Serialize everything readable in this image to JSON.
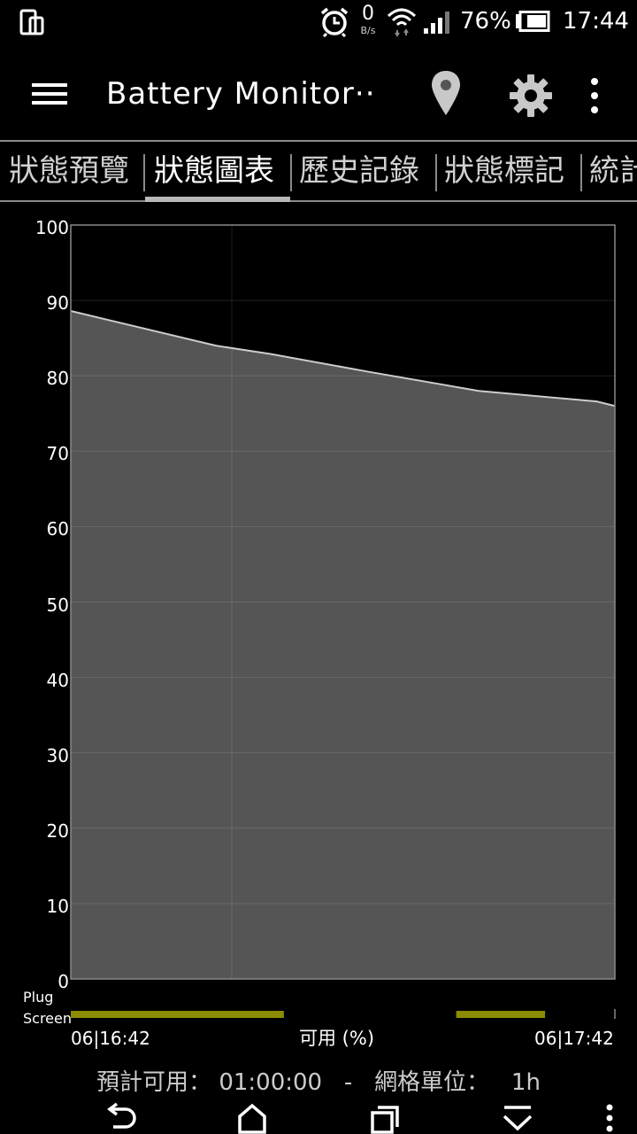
{
  "status_bar": {
    "net_speed": "0",
    "net_unit": "B/s",
    "battery_percent": "76%",
    "time": "17:44",
    "icons": [
      "screen-rotate-icon",
      "alarm-icon",
      "wifi-icon",
      "cell-signal-icon",
      "battery-icon"
    ]
  },
  "appbar": {
    "title": "Battery Monitor··",
    "icons": [
      "menu-icon",
      "location-pin-icon",
      "gear-icon",
      "more-vert-icon"
    ]
  },
  "tabs": [
    {
      "label": "狀態預覽",
      "selected": false
    },
    {
      "label": "狀態圖表",
      "selected": true
    },
    {
      "label": "歷史記錄",
      "selected": false
    },
    {
      "label": "狀態標記",
      "selected": false
    },
    {
      "label": "統計",
      "selected": false
    }
  ],
  "chart_data": {
    "type": "area",
    "xlabel": "可用 (%)",
    "ylim": [
      0,
      100
    ],
    "yticks": [
      "100",
      "90",
      "80",
      "70",
      "60",
      "50",
      "40",
      "30",
      "20",
      "10",
      "0"
    ],
    "x_start_label": "06|16:42",
    "x_end_label": "06|17:42",
    "x_range_minutes": [
      0,
      60
    ],
    "x": [
      0,
      16,
      22,
      33,
      45,
      58,
      60
    ],
    "y": [
      88.6,
      84.0,
      82.9,
      80.5,
      78.0,
      76.6,
      76.0
    ],
    "grid": true,
    "fill_color": "#555555",
    "line_color": "#cccccc",
    "track_labels": {
      "plug": "Plug",
      "screen": "Screen"
    },
    "screen_on_segments_minutes": [
      [
        0,
        23.5
      ],
      [
        42.5,
        52.3
      ]
    ],
    "track_color": "#8c8c00"
  },
  "footer": {
    "estimate_label": "預計可用：",
    "estimate_value": "01:00:00",
    "separator": "-",
    "grid_unit_label": "網格單位：",
    "grid_unit_value": "1h"
  },
  "navbar": {
    "icons": [
      "back-icon",
      "home-icon",
      "recents-icon",
      "collapse-icon",
      "more-vert-icon"
    ]
  }
}
